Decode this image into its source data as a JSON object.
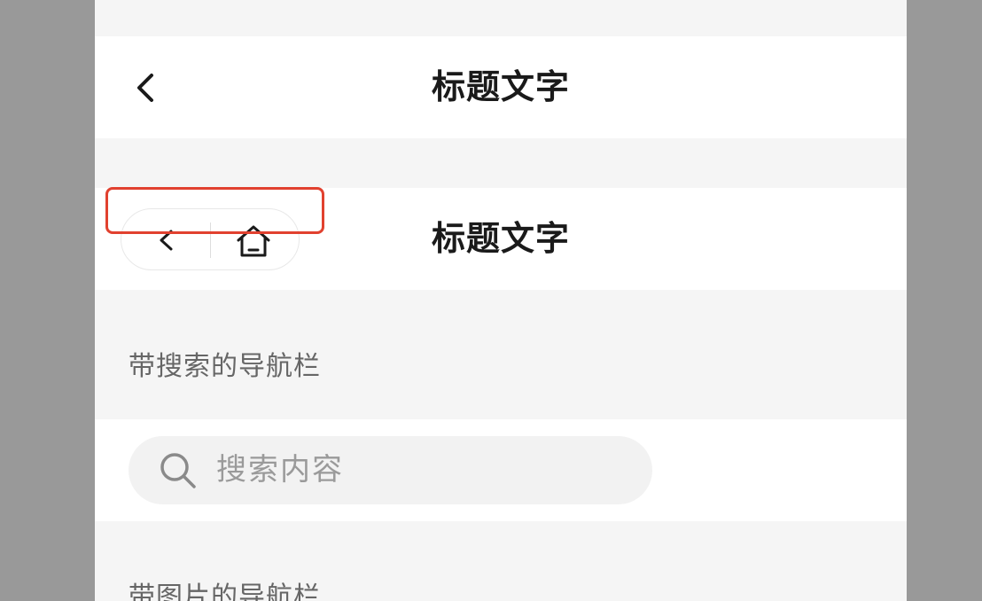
{
  "navbar_basic": {
    "title": "标题文字",
    "back_icon": "chevron-left-icon"
  },
  "navbar_capsule": {
    "title": "标题文字",
    "back_icon": "chevron-left-icon",
    "home_icon": "home-icon"
  },
  "search_section": {
    "label": "带搜索的导航栏",
    "placeholder": "搜索内容",
    "search_icon": "search-icon"
  },
  "image_section": {
    "label": "带图片的导航栏"
  },
  "colors": {
    "backdrop": "#999999",
    "page_bg": "#f5f5f5",
    "bar_bg": "#ffffff",
    "highlight": "#e1412f",
    "title_text": "#1a1a1a",
    "label_text": "#666666",
    "placeholder_text": "#9a9a9a"
  }
}
